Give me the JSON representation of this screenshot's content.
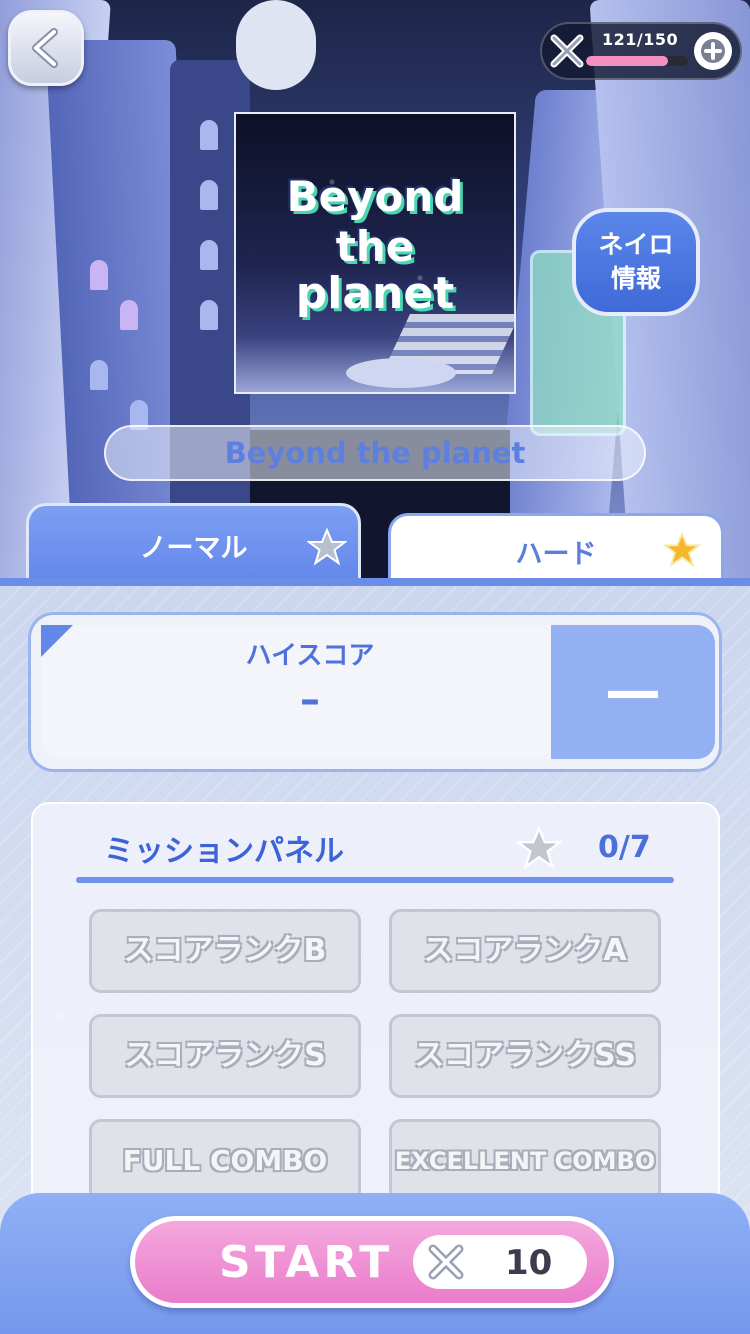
{
  "stamina": {
    "text": "121/150",
    "current": 121,
    "max": 150
  },
  "jacket": {
    "line1": "Beyond",
    "line2": "the",
    "line3": "planet"
  },
  "info_button": {
    "line1": "ネイロ",
    "line2": "情報"
  },
  "song_title": "Beyond the planet",
  "tabs": [
    {
      "label": "ノーマル",
      "selected": true,
      "star_color": "#b8bfce"
    },
    {
      "label": "ハード",
      "selected": false,
      "star_color": "#f5b82a"
    }
  ],
  "highscore": {
    "label": "ハイスコア",
    "value": "–",
    "rank": "—"
  },
  "mission_panel": {
    "title": "ミッションパネル",
    "count": "0/7",
    "missions": [
      "スコアランクB",
      "スコアランクA",
      "スコアランクS",
      "スコアランクSS",
      "FULL COMBO",
      "EXCELLENT COMBO"
    ]
  },
  "start": {
    "label": "START",
    "cost": "10"
  },
  "colors": {
    "accent": "#6387ea",
    "start_pink": "#ea7ccb",
    "title_blue": "#3d63d6"
  }
}
